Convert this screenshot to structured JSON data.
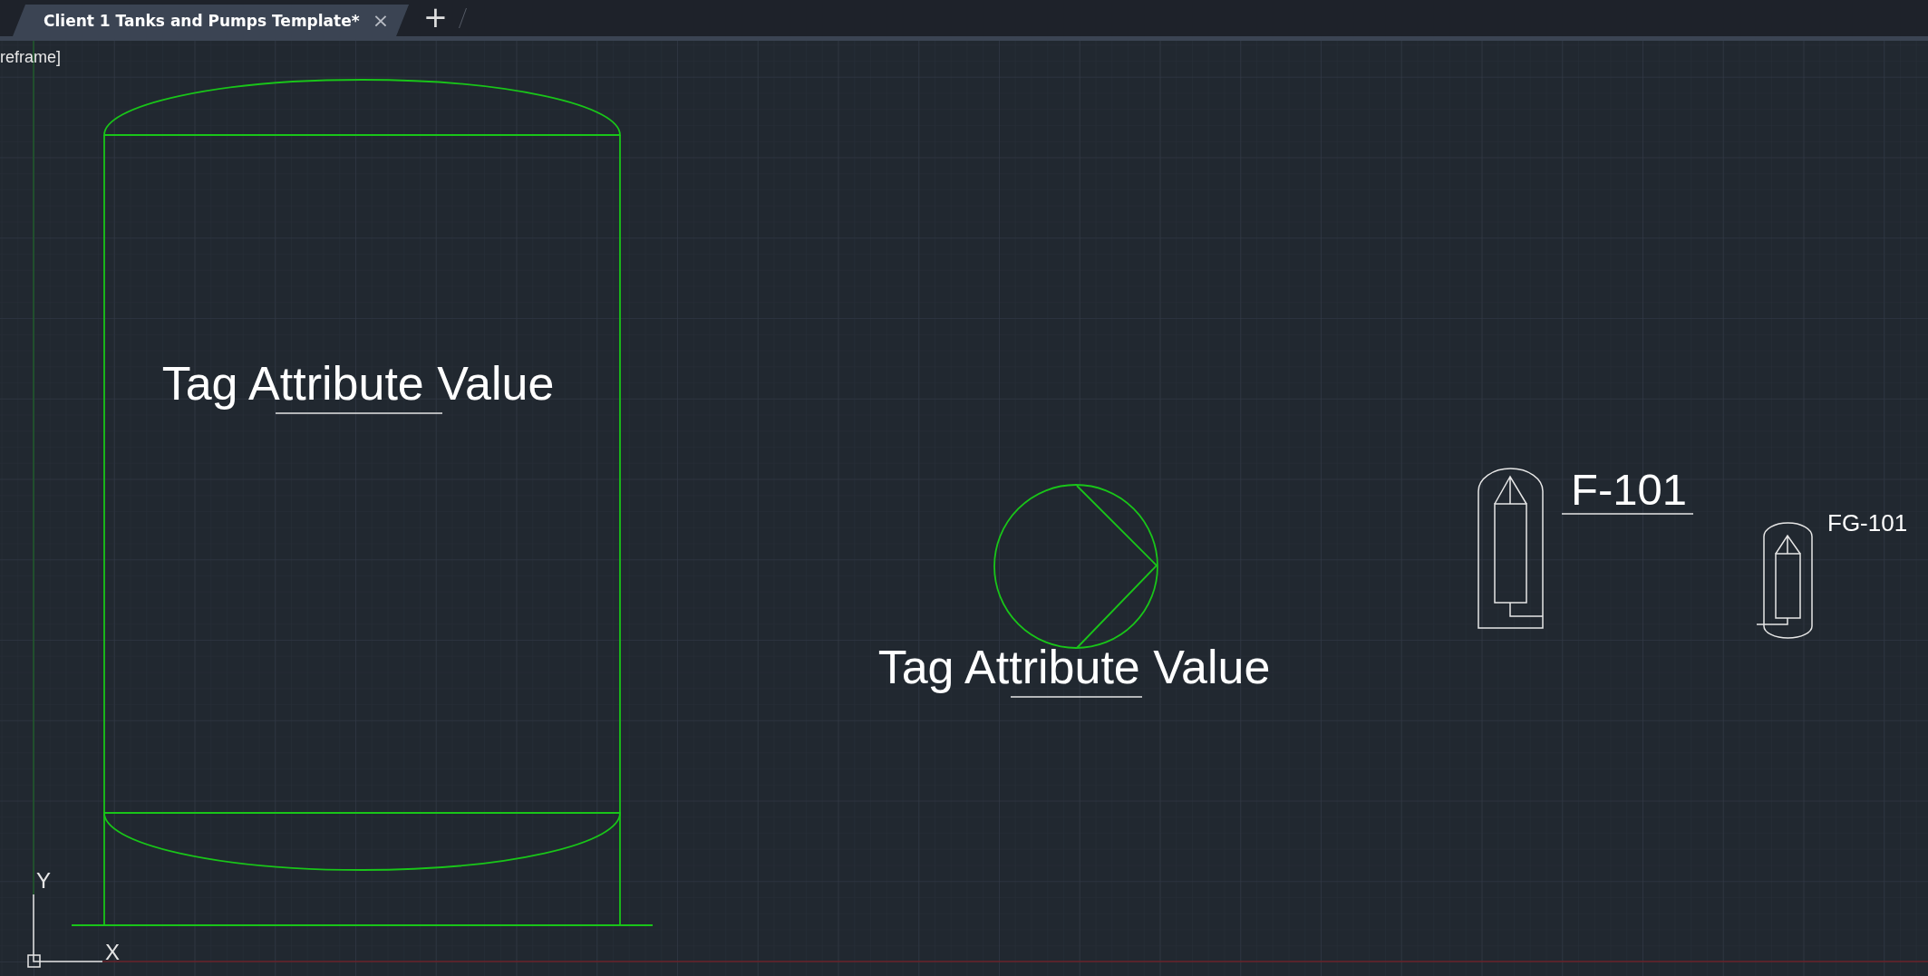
{
  "tabs": [
    {
      "label": "Client 1 Tanks and Pumps Template*",
      "selected": true,
      "close": "×"
    }
  ],
  "new_tab": "+",
  "viewport_label": "reframe]",
  "drawing": {
    "tank": {
      "tag": "Tag Attribute Value"
    },
    "pump": {
      "tag": "Tag Attribute Value"
    },
    "instruments": [
      {
        "tag": "F-101",
        "kind": "large"
      },
      {
        "tag": "FG-101",
        "kind": "small"
      }
    ]
  },
  "ucs": {
    "x_label": "X",
    "y_label": "Y"
  }
}
